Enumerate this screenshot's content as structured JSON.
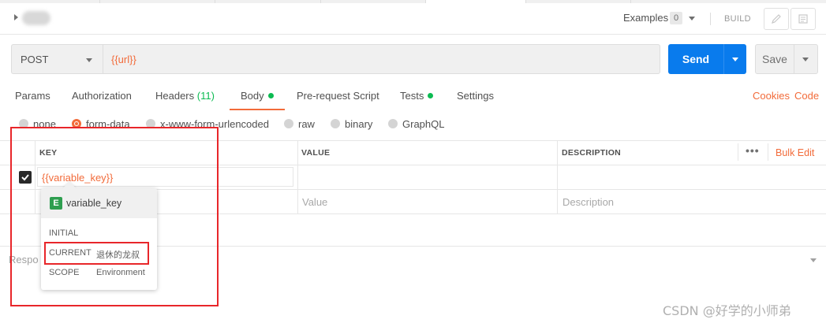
{
  "header": {
    "examples_label": "Examples",
    "examples_count": "0",
    "build_label": "BUILD"
  },
  "request": {
    "method": "POST",
    "url": "{{url}}",
    "send_label": "Send",
    "save_label": "Save"
  },
  "tabs": [
    {
      "label": "Params"
    },
    {
      "label": "Authorization"
    },
    {
      "label": "Headers",
      "count": "(11)"
    },
    {
      "label": "Body",
      "active": true,
      "dot": true
    },
    {
      "label": "Pre-request Script"
    },
    {
      "label": "Tests",
      "dot": true
    },
    {
      "label": "Settings"
    }
  ],
  "tabs_right": {
    "cookies": "Cookies",
    "code": "Code"
  },
  "body_types": [
    {
      "label": "none"
    },
    {
      "label": "form-data",
      "selected": true
    },
    {
      "label": "x-www-form-urlencoded"
    },
    {
      "label": "raw"
    },
    {
      "label": "binary"
    },
    {
      "label": "GraphQL"
    }
  ],
  "table": {
    "headers": {
      "key": "KEY",
      "value": "VALUE",
      "description": "DESCRIPTION"
    },
    "more": "•••",
    "bulk_edit": "Bulk Edit",
    "rows": [
      {
        "key": "{{variable_key}}",
        "checked": true
      }
    ],
    "placeholders": {
      "value": "Value",
      "description": "Description"
    }
  },
  "popover": {
    "badge": "E",
    "variable": "variable_key",
    "initial_label": "INITIAL",
    "current_label": "CURRENT",
    "current_value": "退休的龙叔",
    "scope_label": "SCOPE",
    "scope_value": "Environment"
  },
  "response": {
    "label": "Respo"
  },
  "watermark": "CSDN @好学的小师弟",
  "colors": {
    "accent": "#f26b3a",
    "send": "#097bed",
    "green": "#0cbb52",
    "highlight_box": "#e8262a"
  }
}
